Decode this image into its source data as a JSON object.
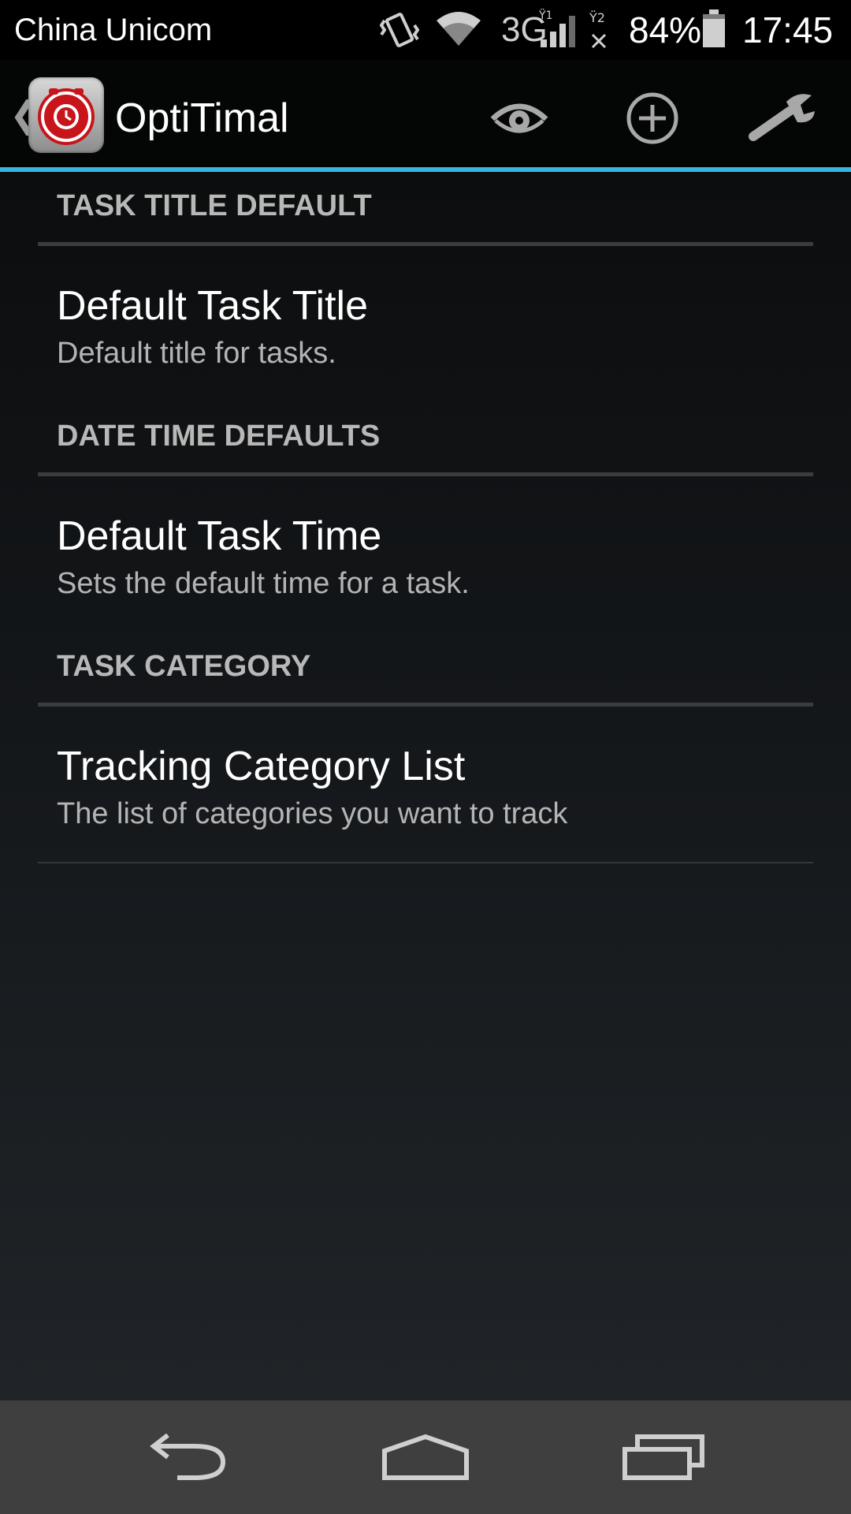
{
  "status_bar": {
    "carrier": "China Unicom",
    "network_type": "3G",
    "battery_percent": "84%",
    "time": "17:45",
    "icons": [
      "vibrate-icon",
      "wifi-icon",
      "signal-3g-sim1-icon",
      "signal-sim2-no-service-icon",
      "battery-icon"
    ]
  },
  "action_bar": {
    "title": "OptiTimal",
    "app_icon": "optitimal-alarm-clock-icon",
    "actions": [
      "eye-icon",
      "add-circle-icon",
      "wrench-icon"
    ],
    "accent_color": "#33b5e5"
  },
  "preferences": {
    "sections": [
      {
        "header": "TASK TITLE DEFAULT",
        "items": [
          {
            "title": "Default Task Title",
            "summary": "Default title for tasks."
          }
        ]
      },
      {
        "header": "DATE TIME DEFAULTS",
        "items": [
          {
            "title": "Default Task Time",
            "summary": "Sets the default time for a task."
          }
        ]
      },
      {
        "header": "TASK CATEGORY",
        "items": [
          {
            "title": "Tracking Category List",
            "summary": "The list of categories you want to track"
          }
        ]
      }
    ]
  },
  "nav_bar": {
    "buttons": [
      "back-icon",
      "home-icon",
      "recent-apps-icon"
    ]
  }
}
